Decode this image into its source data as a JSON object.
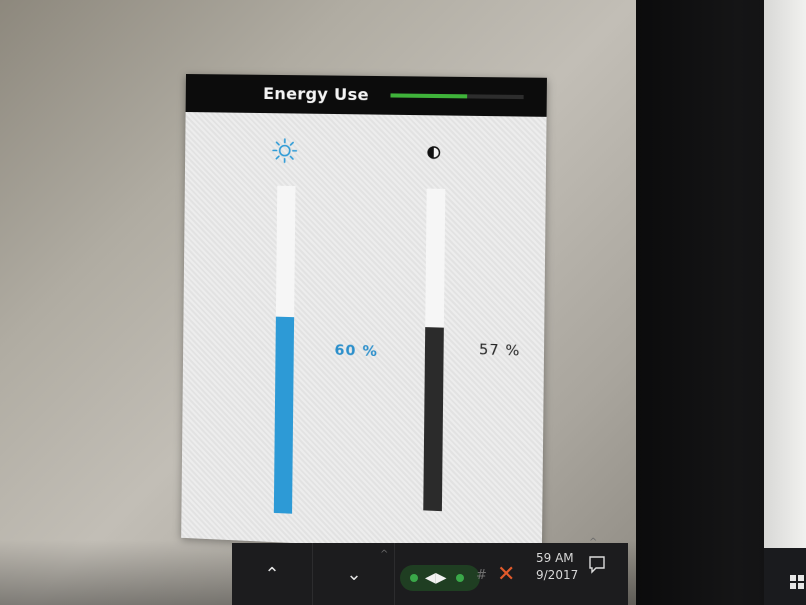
{
  "osd": {
    "title": "Energy Use",
    "energy_level": 0.58,
    "brightness": {
      "icon": "sun-icon",
      "value": 60,
      "label": "60 %",
      "color": "#2d9ad6"
    },
    "contrast": {
      "icon": "contrast-icon",
      "value": 57,
      "label": "57 %",
      "color": "#2b2b2b"
    },
    "accent_color": "#3fb33a"
  },
  "taskbar": {
    "time": "59 AM",
    "date": "9/2017",
    "icons": [
      "chevron-up-icon",
      "chevron-down-icon",
      "network-icon",
      "close-x-icon",
      "notification-icon"
    ]
  }
}
